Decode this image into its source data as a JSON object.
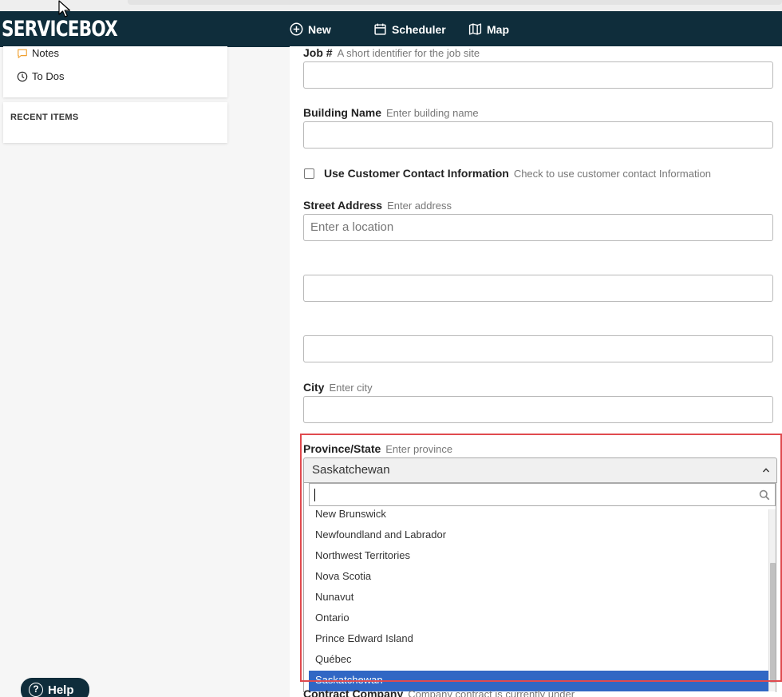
{
  "app": {
    "logo": "SERVICEBOX",
    "nav": {
      "new_label": "New",
      "scheduler_label": "Scheduler",
      "map_label": "Map"
    },
    "help_label": "Help"
  },
  "sidebar": {
    "links": [
      {
        "label": "Notes",
        "icon": "speech-bubble-icon",
        "color": "#f0a030"
      },
      {
        "label": "To Dos",
        "icon": "clock-icon"
      }
    ],
    "recent_items_title": "RECENT ITEMS"
  },
  "form": {
    "job_number": {
      "label": "Job #",
      "hint": "A short identifier for the job site",
      "value": ""
    },
    "building_name": {
      "label": "Building Name",
      "hint": "Enter building name",
      "value": ""
    },
    "use_customer_contact": {
      "label": "Use Customer Contact Information",
      "hint": "Check to use customer contact Information",
      "checked": false
    },
    "street_address": {
      "label": "Street Address",
      "hint": "Enter address",
      "placeholder": "Enter a location",
      "line2": "",
      "line3": ""
    },
    "city": {
      "label": "City",
      "hint": "Enter city",
      "value": ""
    },
    "province": {
      "label": "Province/State",
      "hint": "Enter province",
      "selected": "Saskatchewan",
      "search_value": "",
      "options": [
        "New Brunswick",
        "Newfoundland and Labrador",
        "Northwest Territories",
        "Nova Scotia",
        "Nunavut",
        "Ontario",
        "Prince Edward Island",
        "Québec",
        "Saskatchewan"
      ]
    },
    "contract_company": {
      "label": "Contract Company",
      "hint": "Company contract is currently under"
    }
  },
  "colors": {
    "navbar": "#0f2d3b",
    "highlight_border": "#e04a4f",
    "selected_option": "#3167c4"
  }
}
